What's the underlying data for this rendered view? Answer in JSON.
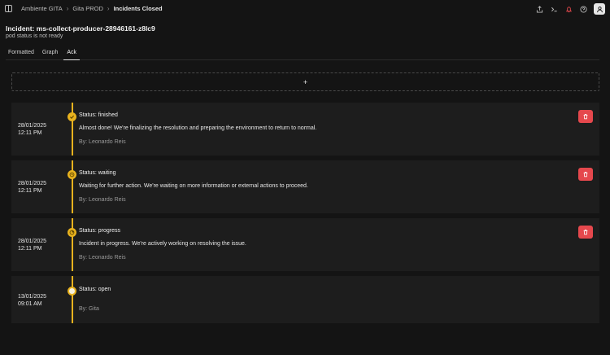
{
  "breadcrumb": {
    "items": [
      "Ambiente GITA",
      "Gita PROD"
    ],
    "current": "Incidents Closed"
  },
  "incident": {
    "title": "Incident: ms-collect-producer-28946161-z8lc9",
    "subtitle": "pod status is not ready"
  },
  "tabs": [
    {
      "label": "Formatted",
      "active": false
    },
    {
      "label": "Graph",
      "active": false
    },
    {
      "label": "Ack",
      "active": true
    }
  ],
  "add_zone": {
    "symbol": "+"
  },
  "entries": [
    {
      "date": "28/01/2025",
      "time": "12:11 PM",
      "status": "Status: finished",
      "message": "Almost done! We're finalizing the resolution and preparing the environment to return to normal.",
      "author": "By: Leonardo Reis",
      "deletable": true
    },
    {
      "date": "28/01/2025",
      "time": "12:11 PM",
      "status": "Status: waiting",
      "message": "Waiting for further action. We're waiting on more information or external actions to proceed.",
      "author": "By: Leonardo Reis",
      "deletable": true
    },
    {
      "date": "28/01/2025",
      "time": "12:11 PM",
      "status": "Status: progress",
      "message": "Incident in progress. We're actively working on resolving the issue.",
      "author": "By: Leonardo Reis",
      "deletable": true
    },
    {
      "date": "13/01/2025",
      "time": "09:01 AM",
      "status": "Status: open",
      "message": "",
      "author": "By: Gita",
      "deletable": false
    }
  ],
  "colors": {
    "accent": "#e8b21e",
    "danger": "#e5484d",
    "background": "#141414",
    "card": "#1d1d1d"
  },
  "icons": [
    "sidebar-toggle-icon",
    "share-icon",
    "terminal-icon",
    "bell-icon",
    "help-icon",
    "user-icon",
    "trash-icon",
    "check-icon",
    "clock-icon"
  ]
}
